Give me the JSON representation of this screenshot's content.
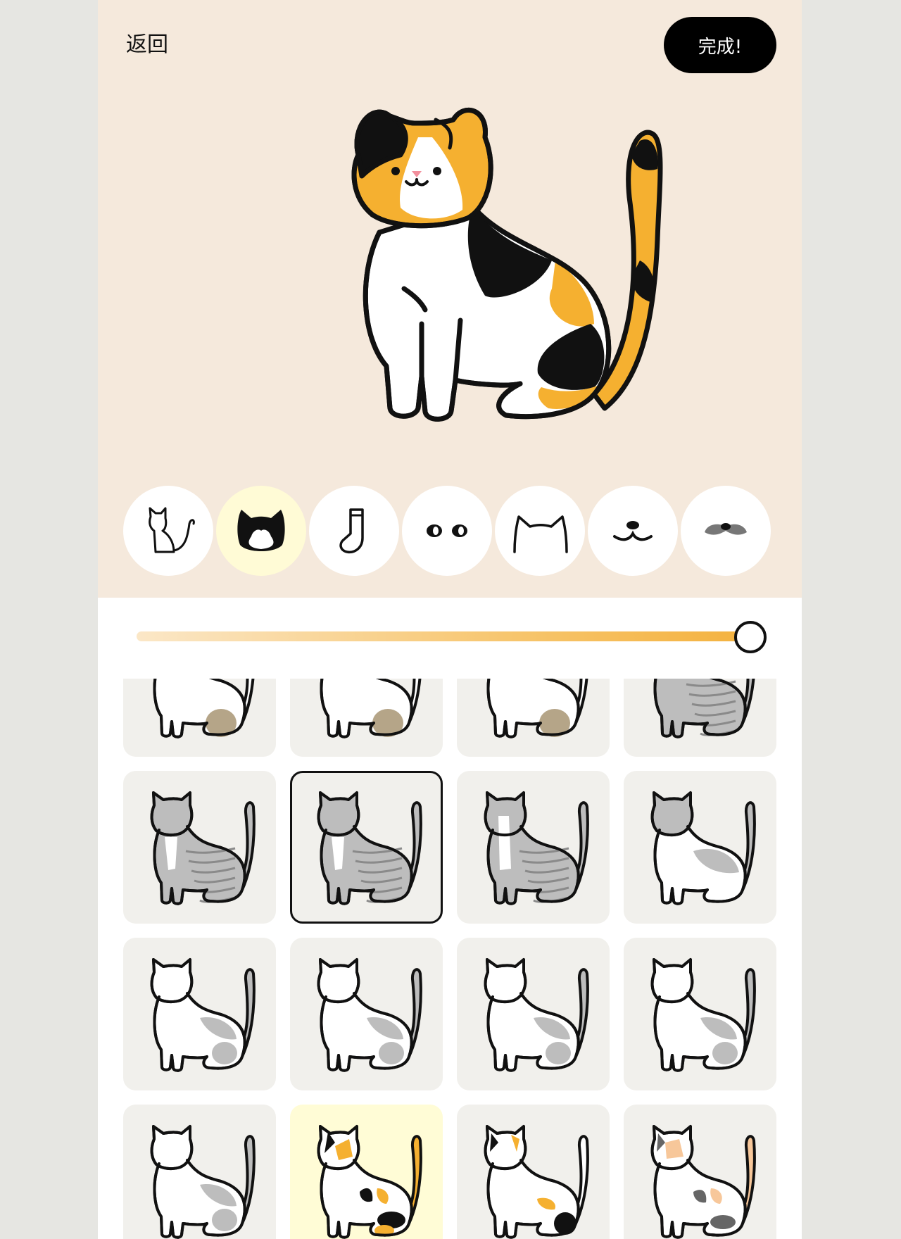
{
  "header": {
    "back_label": "返回",
    "done_label": "完成!"
  },
  "categories": [
    {
      "icon": "cat-body-icon"
    },
    {
      "icon": "cat-face-pattern-icon",
      "selected": true
    },
    {
      "icon": "sock-icon"
    },
    {
      "icon": "eyes-icon"
    },
    {
      "icon": "ears-icon"
    },
    {
      "icon": "mouth-icon"
    },
    {
      "icon": "mustache-icon"
    }
  ],
  "slider": {
    "value_fraction": 1.0
  },
  "colors": {
    "orange": "#f5b030",
    "black": "#111111",
    "gray": "#bdbdbd",
    "stripe": "#8a8a8a",
    "brown": "#b5a588",
    "top_bg": "#f5e9dc",
    "tile_bg": "#f1f0ec",
    "highlight": "#fffbd6"
  },
  "patterns": [
    {
      "pattern": "brown-patch-partial"
    },
    {
      "pattern": "brown-patch-partial"
    },
    {
      "pattern": "brown-patch-partial"
    },
    {
      "pattern": "gray-tabby-partial"
    },
    {
      "pattern": "gray-tabby-white-chest"
    },
    {
      "pattern": "gray-tabby-white-chest",
      "selected": true
    },
    {
      "pattern": "gray-tabby-white-face"
    },
    {
      "pattern": "gray-white-bicolor"
    },
    {
      "pattern": "white-gray-patches-1"
    },
    {
      "pattern": "white-gray-patches-2"
    },
    {
      "pattern": "white-gray-patches-3"
    },
    {
      "pattern": "white-gray-patches-4"
    },
    {
      "pattern": "white-gray-patches-5"
    },
    {
      "pattern": "calico",
      "highlighted": true
    },
    {
      "pattern": "calico-light"
    },
    {
      "pattern": "calico-dilute"
    }
  ]
}
